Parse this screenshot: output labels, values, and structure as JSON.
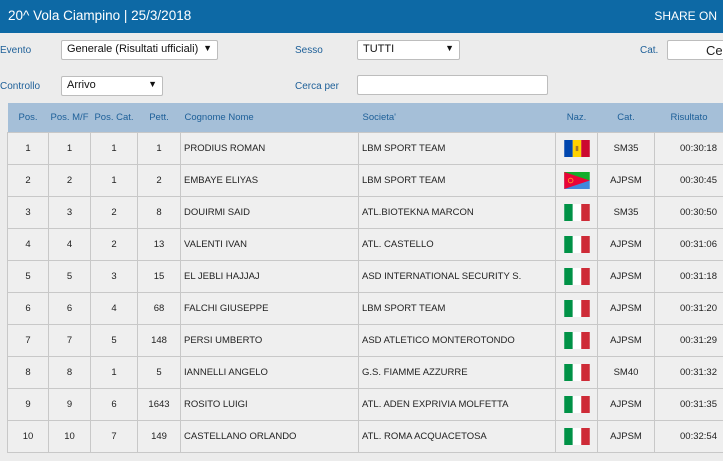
{
  "header": {
    "title": "20^ Vola Ciampino  |  25/3/2018",
    "share_label": "SHARE ON"
  },
  "filters": {
    "evento_label": "Evento",
    "evento_value": "Generale (Risultati ufficiali)",
    "sesso_label": "Sesso",
    "sesso_value": "TUTTI",
    "cat_label": "Cat.",
    "controllo_label": "Controllo",
    "controllo_value": "Arrivo",
    "cerca_label": "Cerca per",
    "cerca_value": "",
    "cerca_button_partial": "Cer"
  },
  "table": {
    "columns": [
      "Pos.",
      "Pos. M/F",
      "Pos. Cat.",
      "Pett.",
      "Cognome Nome",
      "Societa'",
      "Naz.",
      "Cat.",
      "Risultato"
    ],
    "rows": [
      {
        "pos": "1",
        "pos_mf": "1",
        "pos_cat": "1",
        "pett": "1",
        "name": "PRODIUS ROMAN",
        "soc": "LBM SPORT TEAM",
        "naz": "MDA",
        "cat": "SM35",
        "res": "00:30:18"
      },
      {
        "pos": "2",
        "pos_mf": "2",
        "pos_cat": "1",
        "pett": "2",
        "name": "EMBAYE ELIYAS",
        "soc": "LBM SPORT TEAM",
        "naz": "ERI",
        "cat": "AJPSM",
        "res": "00:30:45"
      },
      {
        "pos": "3",
        "pos_mf": "3",
        "pos_cat": "2",
        "pett": "8",
        "name": "DOUIRMI SAID",
        "soc": "ATL.BIOTEKNA MARCON",
        "naz": "ITA",
        "cat": "SM35",
        "res": "00:30:50"
      },
      {
        "pos": "4",
        "pos_mf": "4",
        "pos_cat": "2",
        "pett": "13",
        "name": "VALENTI IVAN",
        "soc": "ATL. CASTELLO",
        "naz": "ITA",
        "cat": "AJPSM",
        "res": "00:31:06"
      },
      {
        "pos": "5",
        "pos_mf": "5",
        "pos_cat": "3",
        "pett": "15",
        "name": "EL JEBLI HAJJAJ",
        "soc": "ASD INTERNATIONAL SECURITY S.",
        "naz": "ITA",
        "cat": "AJPSM",
        "res": "00:31:18"
      },
      {
        "pos": "6",
        "pos_mf": "6",
        "pos_cat": "4",
        "pett": "68",
        "name": "FALCHI GIUSEPPE",
        "soc": "LBM SPORT TEAM",
        "naz": "ITA",
        "cat": "AJPSM",
        "res": "00:31:20"
      },
      {
        "pos": "7",
        "pos_mf": "7",
        "pos_cat": "5",
        "pett": "148",
        "name": "PERSI UMBERTO",
        "soc": "ASD ATLETICO MONTEROTONDO",
        "naz": "ITA",
        "cat": "AJPSM",
        "res": "00:31:29"
      },
      {
        "pos": "8",
        "pos_mf": "8",
        "pos_cat": "1",
        "pett": "5",
        "name": "IANNELLI ANGELO",
        "soc": "G.S. FIAMME AZZURRE",
        "naz": "ITA",
        "cat": "SM40",
        "res": "00:31:32"
      },
      {
        "pos": "9",
        "pos_mf": "9",
        "pos_cat": "6",
        "pett": "1643",
        "name": "ROSITO LUIGI",
        "soc": "ATL. ADEN EXPRIVIA MOLFETTA",
        "naz": "ITA",
        "cat": "AJPSM",
        "res": "00:31:35"
      },
      {
        "pos": "10",
        "pos_mf": "10",
        "pos_cat": "7",
        "pett": "149",
        "name": "CASTELLANO ORLANDO",
        "soc": "ATL. ROMA ACQUACETOSA",
        "naz": "ITA",
        "cat": "AJPSM",
        "res": "00:32:54"
      }
    ]
  },
  "colors": {
    "header_bg": "#0d69a5",
    "table_header_bg": "#a5bfd8",
    "label_blue": "#1d5f98"
  }
}
